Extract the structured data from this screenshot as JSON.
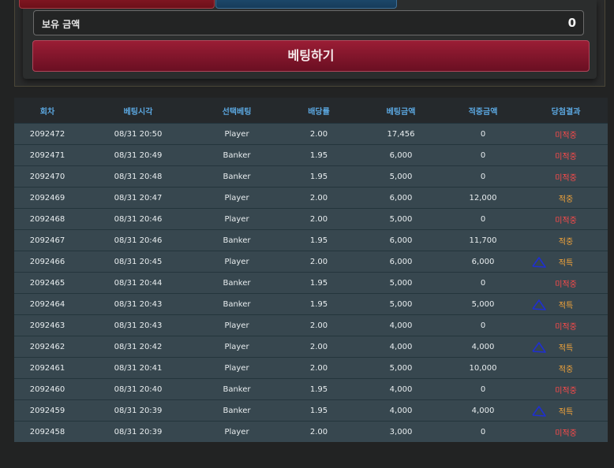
{
  "balance": {
    "label": "보유 금액",
    "value": "0"
  },
  "bet_button": {
    "label": "베팅하기"
  },
  "table": {
    "headers": [
      "회차",
      "베팅시각",
      "선택베팅",
      "배당률",
      "베팅금액",
      "적중금액",
      "당첨결과"
    ],
    "rows": [
      {
        "round": "2092472",
        "time": "08/31 20:50",
        "pick": "Player",
        "odds": "2.00",
        "bet": "17,456",
        "win": "0",
        "result": "미적중"
      },
      {
        "round": "2092471",
        "time": "08/31 20:49",
        "pick": "Banker",
        "odds": "1.95",
        "bet": "6,000",
        "win": "0",
        "result": "미적중"
      },
      {
        "round": "2092470",
        "time": "08/31 20:48",
        "pick": "Banker",
        "odds": "1.95",
        "bet": "5,000",
        "win": "0",
        "result": "미적중"
      },
      {
        "round": "2092469",
        "time": "08/31 20:47",
        "pick": "Player",
        "odds": "2.00",
        "bet": "6,000",
        "win": "12,000",
        "result": "적중"
      },
      {
        "round": "2092468",
        "time": "08/31 20:46",
        "pick": "Player",
        "odds": "2.00",
        "bet": "5,000",
        "win": "0",
        "result": "미적중"
      },
      {
        "round": "2092467",
        "time": "08/31 20:46",
        "pick": "Banker",
        "odds": "1.95",
        "bet": "6,000",
        "win": "11,700",
        "result": "적중"
      },
      {
        "round": "2092466",
        "time": "08/31 20:45",
        "pick": "Player",
        "odds": "2.00",
        "bet": "6,000",
        "win": "6,000",
        "result": "적특"
      },
      {
        "round": "2092465",
        "time": "08/31 20:44",
        "pick": "Banker",
        "odds": "1.95",
        "bet": "5,000",
        "win": "0",
        "result": "미적중"
      },
      {
        "round": "2092464",
        "time": "08/31 20:43",
        "pick": "Banker",
        "odds": "1.95",
        "bet": "5,000",
        "win": "5,000",
        "result": "적특"
      },
      {
        "round": "2092463",
        "time": "08/31 20:43",
        "pick": "Player",
        "odds": "2.00",
        "bet": "4,000",
        "win": "0",
        "result": "미적중"
      },
      {
        "round": "2092462",
        "time": "08/31 20:42",
        "pick": "Player",
        "odds": "2.00",
        "bet": "4,000",
        "win": "4,000",
        "result": "적특"
      },
      {
        "round": "2092461",
        "time": "08/31 20:41",
        "pick": "Player",
        "odds": "2.00",
        "bet": "5,000",
        "win": "10,000",
        "result": "적중"
      },
      {
        "round": "2092460",
        "time": "08/31 20:40",
        "pick": "Banker",
        "odds": "1.95",
        "bet": "4,000",
        "win": "0",
        "result": "미적중"
      },
      {
        "round": "2092459",
        "time": "08/31 20:39",
        "pick": "Banker",
        "odds": "1.95",
        "bet": "4,000",
        "win": "4,000",
        "result": "적특"
      },
      {
        "round": "2092458",
        "time": "08/31 20:39",
        "pick": "Player",
        "odds": "2.00",
        "bet": "3,000",
        "win": "0",
        "result": "미적중"
      }
    ]
  },
  "colors": {
    "lose": "#ff4a4a",
    "win": "#f4a53a",
    "header_text": "#5ba7e0",
    "annotation": "#1f2fd0"
  }
}
